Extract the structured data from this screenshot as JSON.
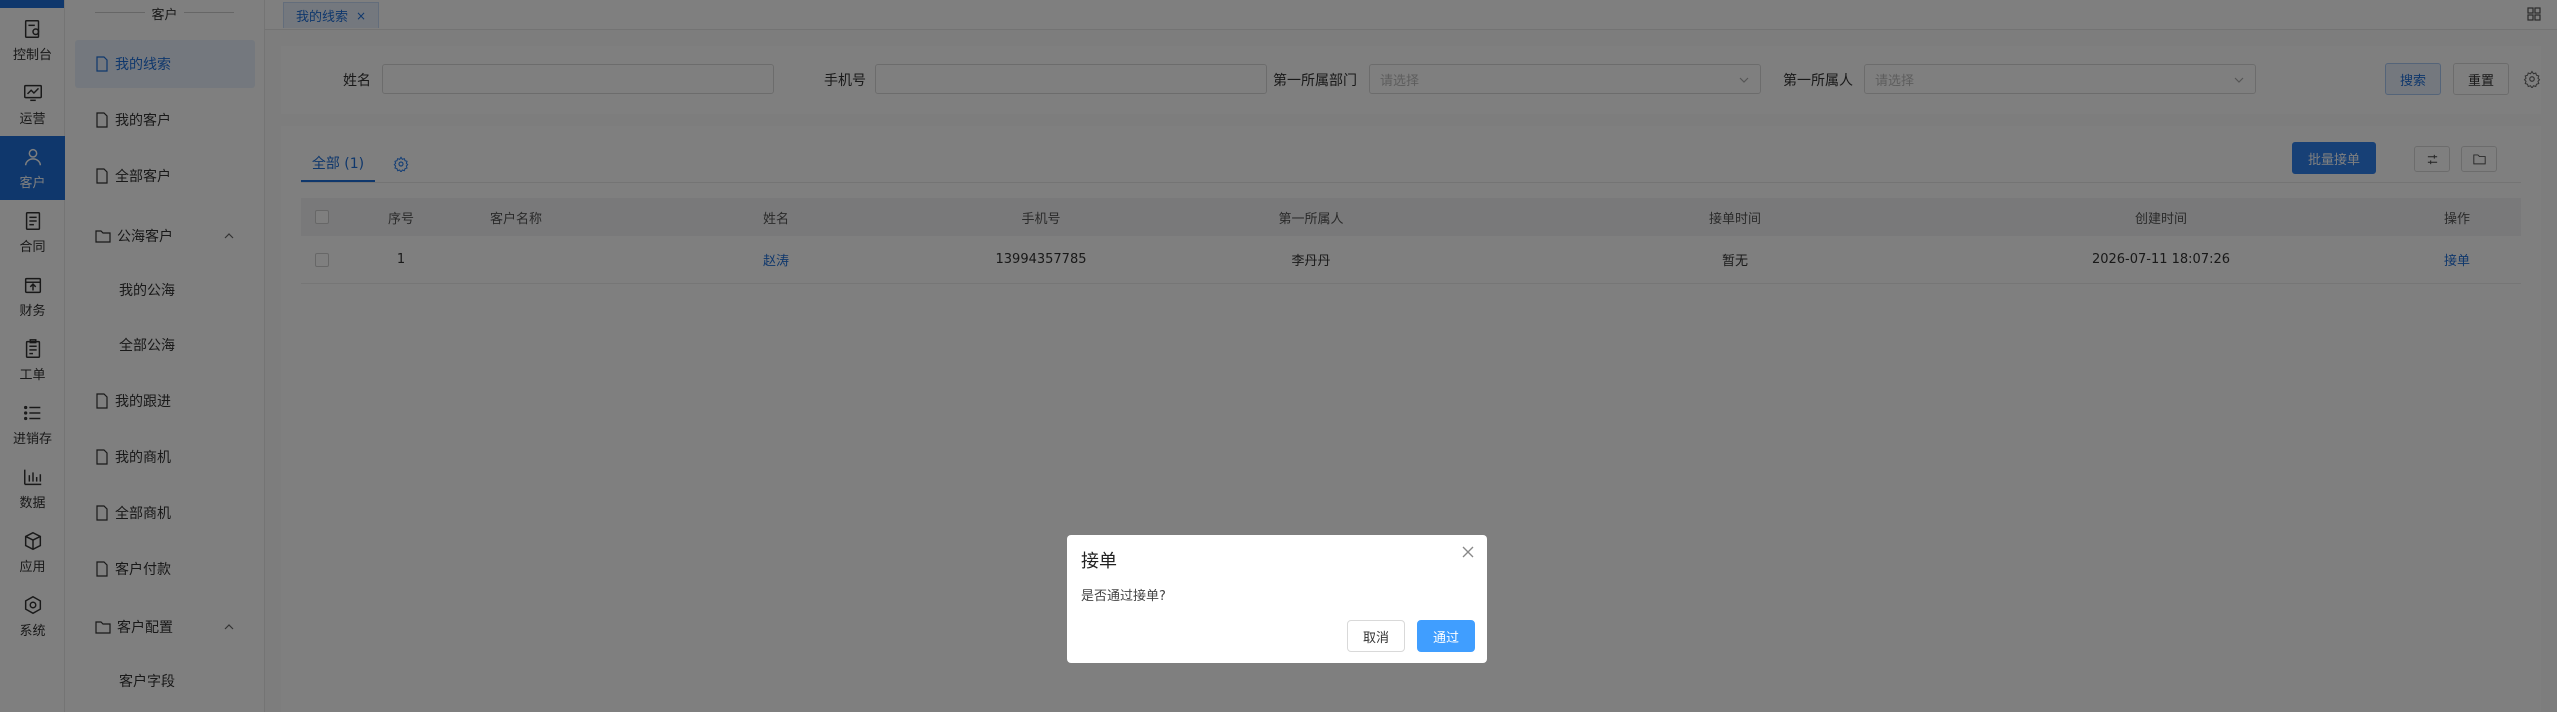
{
  "rail": {
    "items": [
      {
        "label": "控制台",
        "icon": "dashboard-icon"
      },
      {
        "label": "运营",
        "icon": "chart-monitor-icon"
      },
      {
        "label": "客户",
        "icon": "user-icon"
      },
      {
        "label": "合同",
        "icon": "contract-icon"
      },
      {
        "label": "财务",
        "icon": "finance-icon"
      },
      {
        "label": "工单",
        "icon": "ticket-icon"
      },
      {
        "label": "进销存",
        "icon": "list-icon"
      },
      {
        "label": "数据",
        "icon": "bar-chart-icon"
      },
      {
        "label": "应用",
        "icon": "cube-icon"
      },
      {
        "label": "系统",
        "icon": "settings-hex-icon"
      }
    ]
  },
  "menu": {
    "header": "客户",
    "items": [
      {
        "label": "我的线索"
      },
      {
        "label": "我的客户"
      },
      {
        "label": "全部客户"
      },
      {
        "label": "公海客户"
      },
      {
        "label": "我的公海"
      },
      {
        "label": "全部公海"
      },
      {
        "label": "我的跟进"
      },
      {
        "label": "我的商机"
      },
      {
        "label": "全部商机"
      },
      {
        "label": "客户付款"
      },
      {
        "label": "客户配置"
      },
      {
        "label": "客户字段"
      }
    ]
  },
  "tabbar": {
    "tab_label": "我的线索",
    "close": "×"
  },
  "filter": {
    "name_label": "姓名",
    "phone_label": "手机号",
    "dept_label": "第一所属部门",
    "dept_placeholder": "请选择",
    "owner_label": "第一所属人",
    "owner_placeholder": "请选择",
    "search_btn": "搜索",
    "reset_btn": "重置"
  },
  "panel": {
    "tab_all": "全部 (1)",
    "batch_btn": "批量接单"
  },
  "table": {
    "headers": {
      "index": "序号",
      "customer": "客户名称",
      "name": "姓名",
      "phone": "手机号",
      "owner": "第一所属人",
      "accept_time": "接单时间",
      "created": "创建时间",
      "action": "操作"
    },
    "rows": [
      {
        "index": "1",
        "customer": "",
        "name": "赵涛",
        "phone": "13994357785",
        "owner": "李丹丹",
        "accept_time": "暂无",
        "created": "2026-07-11 18:07:26",
        "action": "接单"
      }
    ]
  },
  "dialog": {
    "title": "接单",
    "message": "是否通过接单?",
    "cancel": "取消",
    "confirm": "通过"
  },
  "colors": {
    "primary": "#2f80ed",
    "active_rail": "#1e6fd9"
  }
}
